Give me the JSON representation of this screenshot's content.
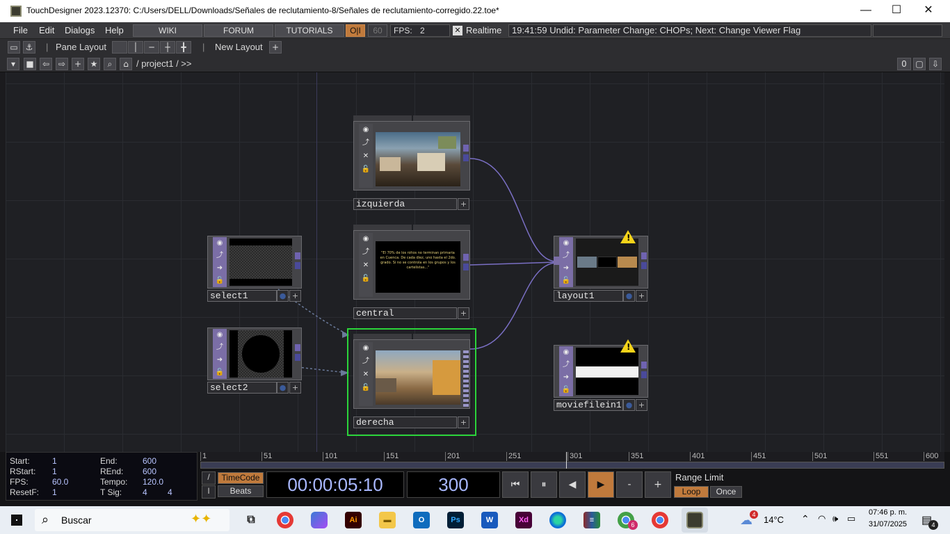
{
  "window": {
    "title": "TouchDesigner 2023.12370: C:/Users/DELL/Downloads/Señales de reclutamiento-8/Señales de reclutamiento-corregido.22.toe*",
    "minimize": "—",
    "maximize": "☐",
    "close": "✕"
  },
  "menubar": {
    "file": "File",
    "edit": "Edit",
    "dialogs": "Dialogs",
    "help": "Help",
    "wiki": "WIKI",
    "forum": "FORUM",
    "tutorials": "TUTORIALS",
    "oi": "O|I",
    "fps_cap": "60",
    "fps_label": "FPS:",
    "fps_value": "2",
    "realtime_checkbox": "✕",
    "realtime_label": "Realtime",
    "status": "19:41:59 Undid: Parameter Change: CHOPs; Next: Change Viewer Flag"
  },
  "toolbar2": {
    "pane_layout": "Pane Layout",
    "new_layout": "New Layout",
    "new_layout_plus": "+"
  },
  "toolbar3": {
    "path": "/ project1 / >>",
    "counter": "0"
  },
  "nodes": {
    "izquierda": {
      "label": "izquierda"
    },
    "central": {
      "label": "central",
      "text": "\"El 70% de los niños no terminan primaria en Cuenca. De cada diez, uno hasta el 2do. grado. Si no se controla en los grupos y los cartelistas...\""
    },
    "derecha": {
      "label": "derecha"
    },
    "select1": {
      "label": "select1"
    },
    "select2": {
      "label": "select2"
    },
    "layout1": {
      "label": "layout1",
      "warning": "!"
    },
    "moviefilein1": {
      "label": "moviefilein1",
      "warning": "!"
    }
  },
  "timeinfo": {
    "start_label": "Start:",
    "start": "1",
    "end_label": "End:",
    "end": "600",
    "rstart_label": "RStart:",
    "rstart": "1",
    "rend_label": "REnd:",
    "rend": "600",
    "fps_label": "FPS:",
    "fps": "60.0",
    "tempo_label": "Tempo:",
    "tempo": "120.0",
    "resetf_label": "ResetF:",
    "resetf": "1",
    "tsig_label": "T Sig:",
    "tsig_a": "4",
    "tsig_b": "4"
  },
  "timeline": {
    "ticks": [
      "1",
      "51",
      "101",
      "151",
      "201",
      "251",
      "301",
      "351",
      "401",
      "451",
      "501",
      "551",
      "600"
    ],
    "playhead_frame": 300
  },
  "transport": {
    "slash": "/",
    "bar": "I",
    "timecode_btn": "TimeCode",
    "beats_btn": "Beats",
    "timecode": "00:00:05:10",
    "frame": "300",
    "rewind": "⏮",
    "pause": "⏸",
    "step_back": "◀",
    "play": "▶",
    "minus": "-",
    "plus": "+",
    "range_limit": "Range Limit",
    "loop": "Loop",
    "once": "Once"
  },
  "taskbar": {
    "search": "Buscar",
    "weather": "14°C",
    "time": "07:46 p. m.",
    "date": "31/07/2025",
    "notif_count": "4",
    "weather_badge": "4",
    "chrome_badge": "6"
  },
  "colors": {
    "accent_orange": "#c07a3c",
    "node_purple": "#7b6ea6",
    "selected_green": "#2bd33a",
    "warning_yellow": "#f4d319",
    "wire": "#7a6fc4"
  }
}
